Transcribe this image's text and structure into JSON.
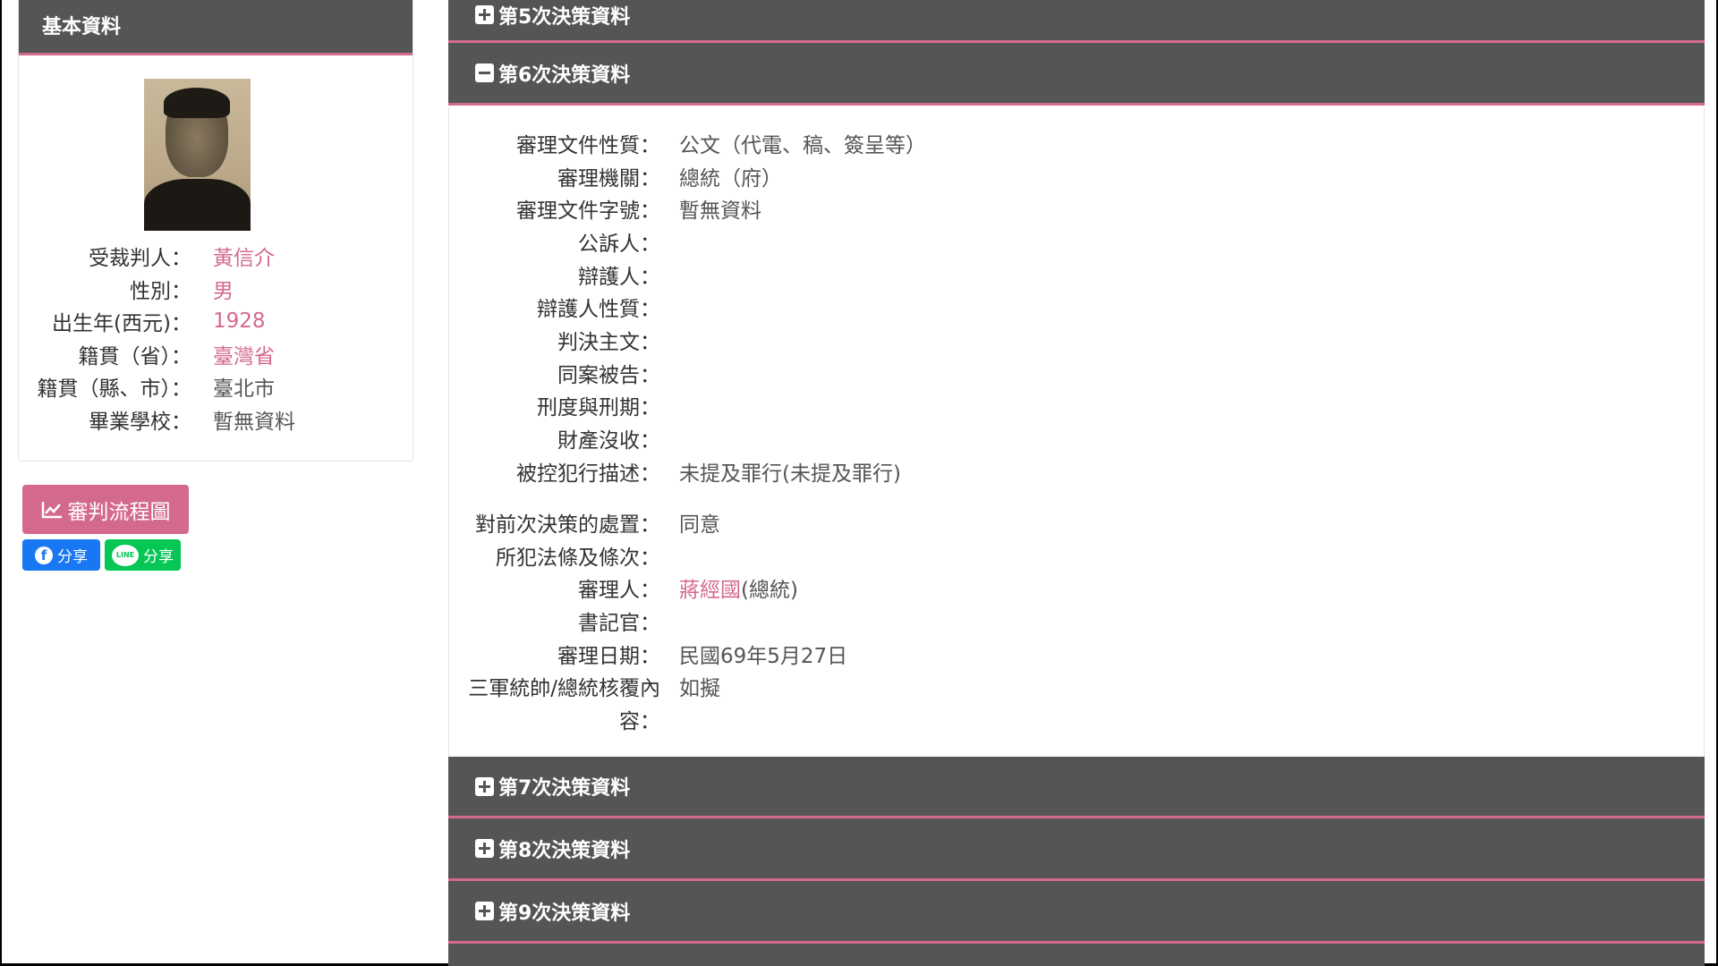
{
  "basic": {
    "header": "基本資料",
    "fields": [
      {
        "label": "受裁判人：",
        "value": "黃信介",
        "link": true
      },
      {
        "label": "性別：",
        "value": "男",
        "link": true
      },
      {
        "label": "出生年(西元)：",
        "value": "1928",
        "link": true
      },
      {
        "label": "籍貫（省）：",
        "value": "臺灣省",
        "link": true
      },
      {
        "label": "籍貫（縣、市）：",
        "value": "臺北市",
        "link": false
      },
      {
        "label": "畢業學校：",
        "value": "暫無資料",
        "link": false
      }
    ],
    "flow_button": "審判流程圖",
    "share_fb": "分享",
    "share_line": "分享",
    "line_logo": "LINE"
  },
  "sections": {
    "s5": "第5次決策資料",
    "s6": "第6次決策資料",
    "s7": "第7次決策資料",
    "s8": "第8次決策資料",
    "s9": "第9次決策資料"
  },
  "detail": {
    "rows": [
      {
        "label": "審理文件性質：",
        "value": "公文（代電、稿、簽呈等）",
        "link": false
      },
      {
        "label": "審理機關：",
        "value": "總統（府）",
        "link": true
      },
      {
        "label": "審理文件字號：",
        "value": "暫無資料",
        "link": false
      },
      {
        "label": "公訴人：",
        "value": "",
        "link": false
      },
      {
        "label": "辯護人：",
        "value": "",
        "link": false
      },
      {
        "label": "辯護人性質：",
        "value": "",
        "link": false
      },
      {
        "label": "判決主文：",
        "value": "",
        "link": false
      },
      {
        "label": "同案被告：",
        "value": "",
        "link": false
      },
      {
        "label": "刑度與刑期：",
        "value": "",
        "link": false
      },
      {
        "label": "財產沒收：",
        "value": "",
        "link": false
      },
      {
        "label": "被控犯行描述：",
        "value": "未提及罪行(未提及罪行)",
        "link": false
      },
      {
        "label": "對前次決策的處置：",
        "value": "同意",
        "link": false
      },
      {
        "label": "所犯法條及條次：",
        "value": "",
        "link": false
      },
      {
        "label": "審理人：",
        "value": "(總統)",
        "link_prefix": "蔣經國"
      },
      {
        "label": "書記官：",
        "value": "",
        "link": false
      },
      {
        "label": "審理日期：",
        "value": "民國69年5月27日",
        "link": false
      },
      {
        "label": "三軍統帥/總統核覆內",
        "label2": "容：",
        "value": "如擬",
        "link": false
      }
    ]
  },
  "colors": {
    "accent": "#d4698f",
    "header_bg": "#555555",
    "facebook": "#1877f2",
    "line": "#06c755"
  }
}
